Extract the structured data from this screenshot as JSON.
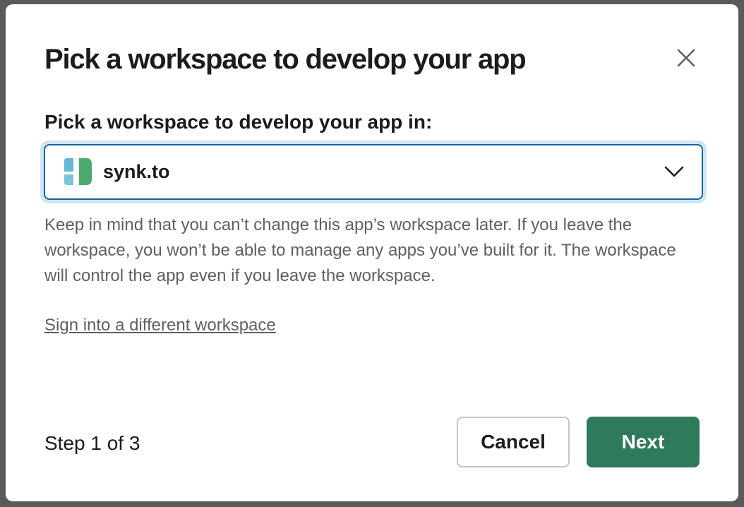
{
  "modal": {
    "title": "Pick a workspace to develop your app",
    "close_icon": "close-icon"
  },
  "workspace_field": {
    "label": "Pick a workspace to develop your app in:",
    "selected": "synk.to",
    "logo_icon": "synk-logo-icon",
    "dropdown_icon": "chevron-down-icon",
    "colors": {
      "logo_blue": "#63b8d9",
      "logo_green": "#4daa6e",
      "focus_border": "#1264a3"
    }
  },
  "help_text": "Keep in mind that you can’t change this app’s workspace later. If you leave the workspace, you won’t be able to manage any apps you’ve built for it. The workspace will control the app even if you leave the workspace.",
  "sign_in_link": "Sign into a different workspace",
  "footer": {
    "step": "Step 1 of 3",
    "cancel_label": "Cancel",
    "next_label": "Next",
    "next_color": "#2f7a5a"
  }
}
